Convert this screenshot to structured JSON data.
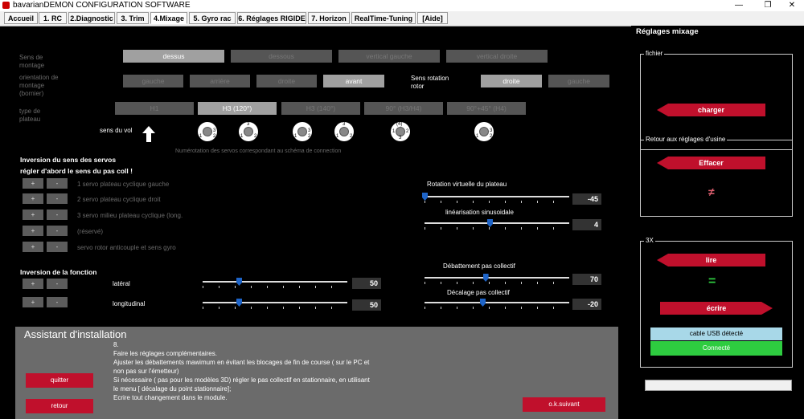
{
  "window": {
    "title": "bavarianDEMON CONFIGURATION SOFTWARE",
    "minimize": "—",
    "maximize": "❐",
    "close": "✕"
  },
  "tabs": [
    {
      "label": "Accueil"
    },
    {
      "label": "1. RC"
    },
    {
      "label": "2.Diagnostic"
    },
    {
      "label": "3. Trim"
    },
    {
      "label": "4.Mixage",
      "active": true
    },
    {
      "label": "5. Gyro rac"
    },
    {
      "label": "6. Réglages RIGIDE"
    },
    {
      "label": "7. Horizon"
    },
    {
      "label": "RealTime-Tuning"
    },
    {
      "label": "[Aide]"
    }
  ],
  "mounting": {
    "label": "Sens de montage",
    "options": [
      "dessus",
      "dessous",
      "vertical gauche",
      "vertical droite"
    ],
    "selected": "dessus"
  },
  "orientation": {
    "label": "orientation de montage (bornier)",
    "options": [
      "gauche",
      "arrière",
      "droite",
      "avant"
    ],
    "selected": "avant"
  },
  "rotor": {
    "label": "Sens rotation rotor",
    "options": [
      "droite",
      "gauche"
    ],
    "selected": "droite"
  },
  "plate": {
    "label": "type de plateau",
    "options": [
      "H1",
      "H3 (120°)",
      "H3 (140°)",
      "90° (H3/H4)",
      "90°+45° (H4)"
    ],
    "selected": "H3 (120°)"
  },
  "flight_direction_label": "sens du vol",
  "servo_diagrams": [
    {
      "top": "",
      "left": "1",
      "right": "3",
      "bottom": "2"
    },
    {
      "top": "3",
      "left": "1",
      "right": "2",
      "bottom": ""
    },
    {
      "top": "",
      "left": "1",
      "right": "3",
      "bottom": "2"
    },
    {
      "top": "3",
      "left": "1",
      "right": "2",
      "bottom": ""
    },
    {
      "top": "(4)",
      "left": "1",
      "right": "2",
      "bottom": "3"
    },
    {
      "top": "",
      "left": "1",
      "right": "3",
      "bottom": "2"
    }
  ],
  "servo_numbering_note": "Numérotation des servos correspondant au schéma de connection",
  "servo_inversion": {
    "title": "Inversion du sens des servos",
    "subtitle": "régler d'abord le sens du pas coll !",
    "plus": "+",
    "minus": "-",
    "rows": [
      {
        "label": "1 servo plateau cyclique gauche"
      },
      {
        "label": "2 servo plateau cyclique droit"
      },
      {
        "label": "3 servo milieu plateau cyclique (long."
      },
      {
        "label": "(réservé)"
      },
      {
        "label": "servo rotor anticouple et sens gyro"
      }
    ]
  },
  "function_inversion": {
    "title": "Inversion de la fonction",
    "rows": [
      {
        "label": "latéral",
        "value": "50",
        "fraction": 0.25
      },
      {
        "label": "longitudinal",
        "value": "50",
        "fraction": 0.25
      }
    ]
  },
  "right_sliders": [
    {
      "label": "Rotation virtuelle du plateau",
      "value": "-45",
      "fraction": 0.0
    },
    {
      "label": "linéarisation sinusoidale",
      "value": "4",
      "fraction": 0.45
    },
    {
      "label": "Débattement pas collectif",
      "value": "70",
      "fraction": 0.42
    },
    {
      "label": "Décalage pas collectif",
      "value": "-20",
      "fraction": 0.4
    }
  ],
  "assistant": {
    "title": "Assistant d'installation",
    "step": "8.",
    "lines": [
      "Faire les réglages complémentaires.",
      "Ajuster les débattements mawimum en évitant les blocages de fin de course ( sur le PC et",
      "non pas sur l'émetteur)",
      "Si nécessaire ( pas pour les modèles 3D) régler le pas collectif en stationnaire, en utilisant",
      "le menu [ décalage du point stationnaire];",
      "Ecrire tout changement dans le module."
    ],
    "quit": "quitter",
    "back": "retour",
    "next": "o.k.suivant"
  },
  "right_panel": {
    "title": "Réglages mixage",
    "file_group": "fichier",
    "load": "charger",
    "factory_group": "Retour aux réglages d'usine",
    "erase": "Effacer",
    "not_equal": "≠",
    "x3_group": "3X",
    "read": "lire",
    "equal": "=",
    "write": "écrire",
    "usb_status": "cable USB détecté",
    "connected": "Connecté"
  },
  "colors": {
    "accent_red": "#c0102c",
    "usb_blue": "#a8d8e8",
    "connected_green": "#2ecc40",
    "slider_thumb": "#1e64c8"
  }
}
